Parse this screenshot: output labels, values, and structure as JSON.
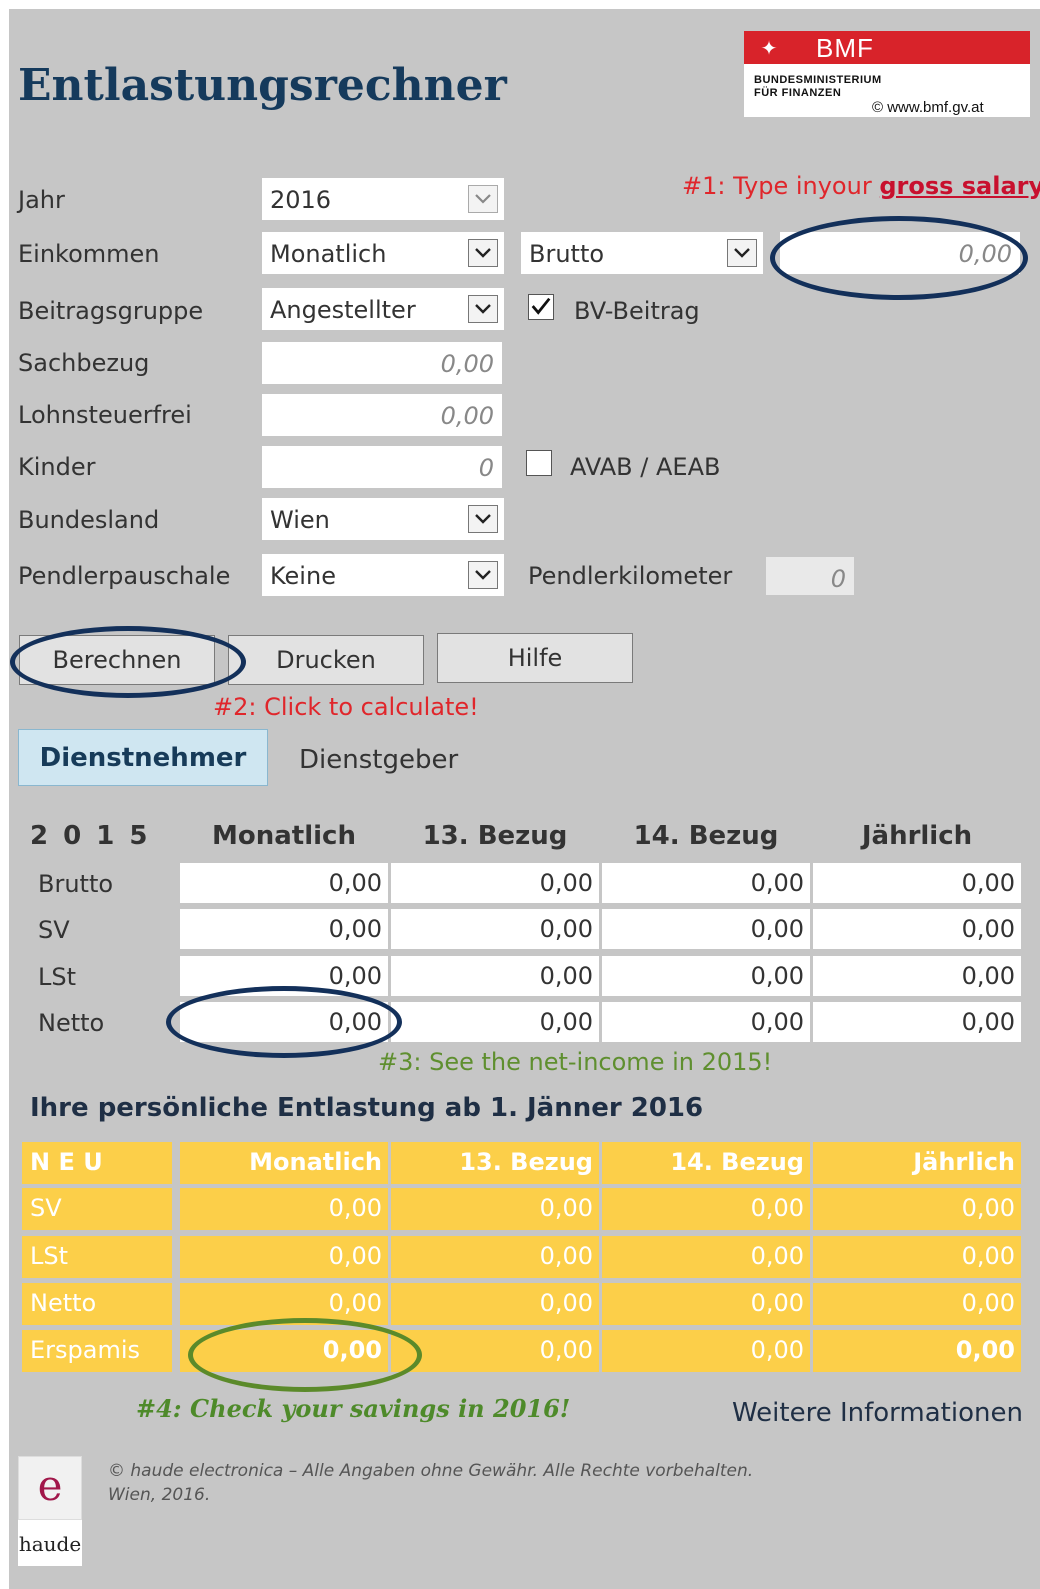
{
  "header": {
    "title": "Entlastungsrechner",
    "logo_brand": "BMF",
    "logo_line1": "BUNDESMINISTERIUM",
    "logo_line2": "FÜR FINANZEN",
    "logo_url": "© www.bmf.gv.at"
  },
  "form": {
    "jahr": {
      "label": "Jahr",
      "value": "2016"
    },
    "einkommen": {
      "label": "Einkommen",
      "period": "Monatlich",
      "type": "Brutto",
      "amount": "0,00"
    },
    "beitragsgruppe": {
      "label": "Beitragsgruppe",
      "value": "Angestellter",
      "bv_label": "BV-Beitrag",
      "bv_checked": true
    },
    "sachbezug": {
      "label": "Sachbezug",
      "value": "0,00"
    },
    "lohnsteuerfrei": {
      "label": "Lohnsteuerfrei",
      "value": "0,00"
    },
    "kinder": {
      "label": "Kinder",
      "value": "0",
      "avab_label": "AVAB / AEAB",
      "avab_checked": false
    },
    "bundesland": {
      "label": "Bundesland",
      "value": "Wien"
    },
    "pendlerpauschale": {
      "label": "Pendlerpauschale",
      "value": "Keine",
      "km_label": "Pendlerkilometer",
      "km_value": "0"
    }
  },
  "buttons": {
    "calculate": "Berechnen",
    "print": "Drucken",
    "help": "Hilfe"
  },
  "tabs": {
    "employee": "Dienstnehmer",
    "employer": "Dienstgeber"
  },
  "table_2015": {
    "year_label": "2 0 1 5",
    "columns": [
      "Monatlich",
      "13. Bezug",
      "14. Bezug",
      "Jährlich"
    ],
    "rows": [
      {
        "label": "Brutto",
        "values": [
          "0,00",
          "0,00",
          "0,00",
          "0,00"
        ]
      },
      {
        "label": "SV",
        "values": [
          "0,00",
          "0,00",
          "0,00",
          "0,00"
        ]
      },
      {
        "label": "LSt",
        "values": [
          "0,00",
          "0,00",
          "0,00",
          "0,00"
        ]
      },
      {
        "label": "Netto",
        "values": [
          "0,00",
          "0,00",
          "0,00",
          "0,00"
        ]
      }
    ]
  },
  "relief": {
    "heading": "Ihre persönliche Entlastung ab 1. Jänner 2016",
    "neu_label": "N E U",
    "columns": [
      "Monatlich",
      "13. Bezug",
      "14. Bezug",
      "Jährlich"
    ],
    "rows": [
      {
        "label": "SV",
        "values": [
          "0,00",
          "0,00",
          "0,00",
          "0,00"
        ]
      },
      {
        "label": "LSt",
        "values": [
          "0,00",
          "0,00",
          "0,00",
          "0,00"
        ]
      },
      {
        "label": "Netto",
        "values": [
          "0,00",
          "0,00",
          "0,00",
          "0,00"
        ]
      },
      {
        "label": "Erspamis",
        "values": [
          "0,00",
          "0,00",
          "0,00",
          "0,00"
        ]
      }
    ]
  },
  "annotations": {
    "step1_prefix": "#1: Type inyour ",
    "step1_link": "gross salary",
    "step1_suffix": "!",
    "step2": "#2: Click to calculate!",
    "step3": "#3: See the net-income in 2015!",
    "step4": "#4: Check your savings in 2016!"
  },
  "more_info": "Weitere Informationen",
  "footer": {
    "copyright_line1": "© haude electronica – Alle Angaben ohne Gewähr. Alle Rechte vorbehalten.",
    "copyright_line2": "Wien, 2016.",
    "logo_letter": "e",
    "logo_text": "haude"
  },
  "colors": {
    "title": "#153a5c",
    "annotation_red": "#e0262b",
    "annotation_green": "#5f8f2f",
    "relief_yellow": "#fccf49",
    "oval_blue": "#13305a",
    "oval_green": "#5b8a2a",
    "bmf_red": "#d8232a"
  }
}
